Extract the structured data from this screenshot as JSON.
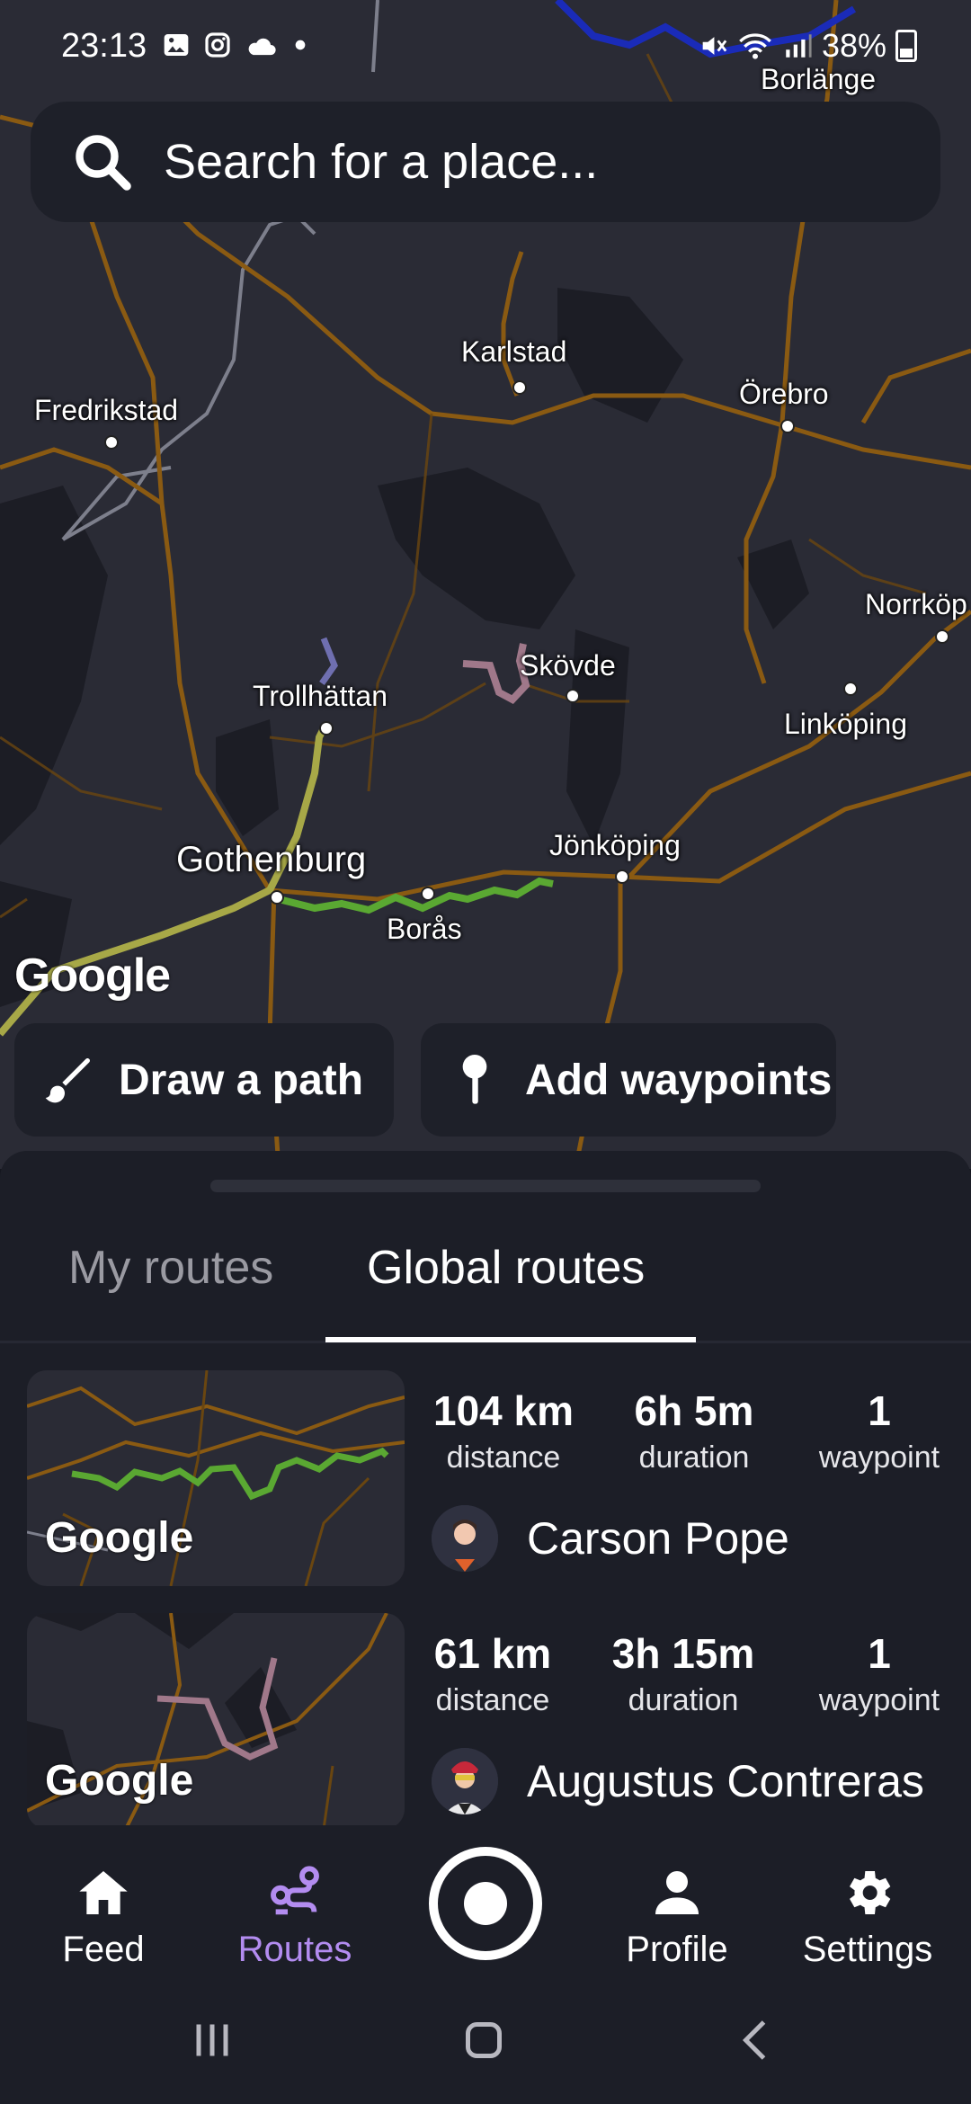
{
  "status": {
    "time": "23:13",
    "battery": "38%",
    "icons": [
      "gallery-icon",
      "instagram-icon",
      "cloud-icon",
      "dot-icon"
    ]
  },
  "search": {
    "placeholder": "Search for a place..."
  },
  "map": {
    "attribution": "Google",
    "cities": {
      "borlange": "Borlänge",
      "karlstad": "Karlstad",
      "orebro": "Örebro",
      "fredrikstad": "Fredrikstad",
      "norrkoping": "Norrköp",
      "skovde": "Skövde",
      "trollhattan": "Trollhättan",
      "linkoping": "Linköping",
      "gothenburg": "Gothenburg",
      "jonkoping": "Jönköping",
      "boras": "Borås"
    },
    "buttons": {
      "draw_path": "Draw a path",
      "add_waypoints": "Add waypoints"
    }
  },
  "tabs": {
    "my_routes": "My routes",
    "global_routes": "Global routes",
    "active": "Global routes"
  },
  "routes": [
    {
      "distance": "104 km",
      "distance_label": "distance",
      "duration": "6h 5m",
      "duration_label": "duration",
      "waypoints": "1",
      "waypoints_label": "waypoint",
      "author": "Carson Pope",
      "thumb_attribution": "Google",
      "route_color": "#5aa832"
    },
    {
      "distance": "61 km",
      "distance_label": "distance",
      "duration": "3h 15m",
      "duration_label": "duration",
      "waypoints": "1",
      "waypoints_label": "waypoint",
      "author": "Augustus Contreras",
      "thumb_attribution": "Google",
      "route_color": "#a0788a"
    }
  ],
  "nav": {
    "feed": "Feed",
    "routes": "Routes",
    "profile": "Profile",
    "settings": "Settings",
    "active": "Routes",
    "active_color": "#b38cf0"
  }
}
